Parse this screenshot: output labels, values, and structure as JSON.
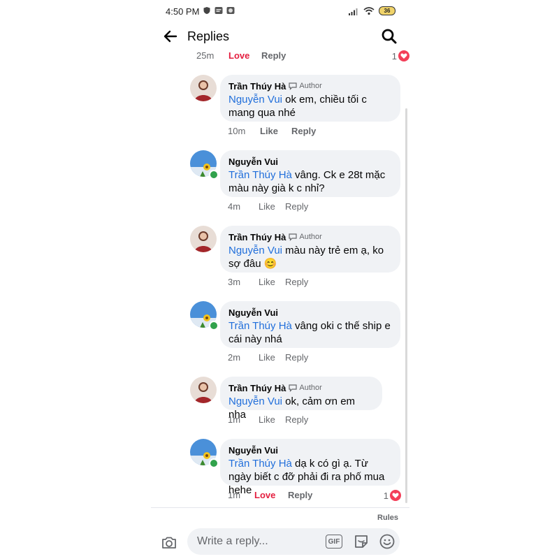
{
  "status_bar": {
    "time": "4:50 PM",
    "battery": "36"
  },
  "header": {
    "title": "Replies"
  },
  "top_row": {
    "time": "25m",
    "love": "Love",
    "reply": "Reply",
    "reactions": "1"
  },
  "comments": [
    {
      "author": "Trần Thúy Hà",
      "badge": "Author",
      "mention": "Nguyễn Vui",
      "text": " ok em, chiều tối c mang qua nhé",
      "time": "10m",
      "like": "Like",
      "reply": "Reply"
    },
    {
      "author": "Nguyễn Vui",
      "mention": "Trần Thúy Hà",
      "text": " vâng. Ck e 28t mặc màu này già k c nhỉ?",
      "time": "4m",
      "like": "Like",
      "reply": "Reply"
    },
    {
      "author": "Trần Thúy Hà",
      "badge": "Author",
      "mention": "Nguyễn Vui",
      "text": " màu này trẻ em ạ, ko sợ đâu 😊",
      "time": "3m",
      "like": "Like",
      "reply": "Reply"
    },
    {
      "author": "Nguyễn Vui",
      "mention": "Trần Thúy Hà",
      "text": " vâng oki c thế ship e cái này nhá",
      "time": "2m",
      "like": "Like",
      "reply": "Reply"
    },
    {
      "author": "Trần Thúy Hà",
      "badge": "Author",
      "mention": "Nguyễn Vui",
      "text": " ok, cảm ơn em nha",
      "time": "1m",
      "like": "Like",
      "reply": "Reply"
    },
    {
      "author": "Nguyễn Vui",
      "mention": "Trần Thúy Hà",
      "text": " dạ k có gì ạ. Từ ngày biết c đỡ phải đi ra phố mua hehe",
      "time": "1m",
      "love": "Love",
      "reply": "Reply",
      "reactions": "1"
    }
  ],
  "footer": {
    "rules": "Rules",
    "placeholder": "Write a reply...",
    "gif": "GIF"
  },
  "colors": {
    "mention": "#216fdb",
    "love": "#e41e3f",
    "bubble": "#f0f2f5",
    "online": "#31a24c"
  },
  "icons": [
    "back-arrow-icon",
    "search-icon",
    "heart-icon",
    "camera-icon",
    "gif-icon",
    "sticker-icon",
    "emoji-icon",
    "speech-bubble-icon"
  ]
}
